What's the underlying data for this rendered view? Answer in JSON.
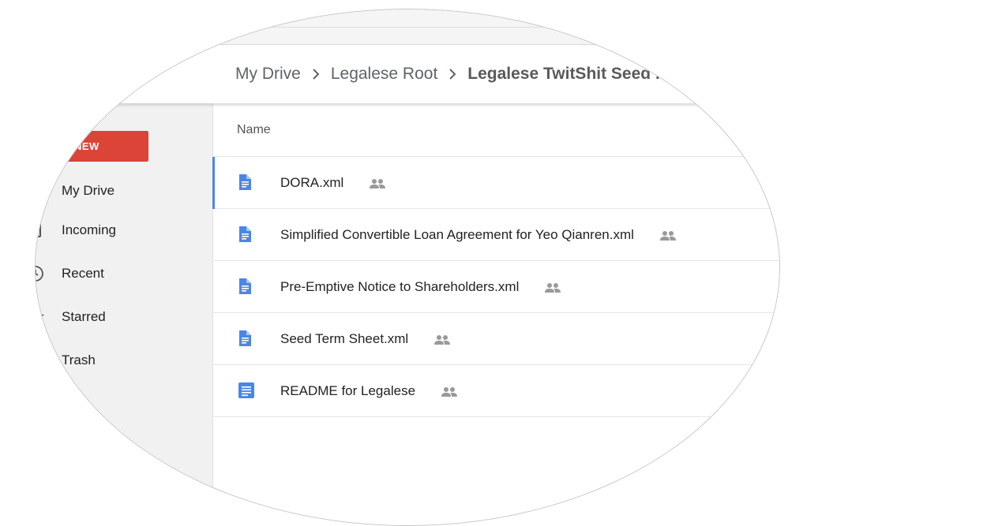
{
  "breadcrumb": {
    "items": [
      "My Drive",
      "Legalese Root"
    ],
    "current": "Legalese TwitShit Seed ."
  },
  "sidebar": {
    "new_label": "NEW",
    "items": [
      {
        "label": "My Drive",
        "icon": "drive-icon"
      },
      {
        "label": "Incoming",
        "icon": "incoming-icon"
      },
      {
        "label": "Recent",
        "icon": "clock-icon"
      },
      {
        "label": "Starred",
        "icon": "star-icon"
      },
      {
        "label": "Trash",
        "icon": "trash-icon"
      }
    ]
  },
  "list": {
    "column_name": "Name",
    "files": [
      {
        "name": "DORA.xml",
        "type": "file-icon",
        "shared": true,
        "selected": true
      },
      {
        "name": "Simplified Convertible Loan Agreement for Yeo Qianren.xml",
        "type": "file-icon",
        "shared": true
      },
      {
        "name": "Pre-Emptive Notice to Shareholders.xml",
        "type": "file-icon",
        "shared": true
      },
      {
        "name": "Seed Term Sheet.xml",
        "type": "file-icon",
        "shared": true
      },
      {
        "name": "README for Legalese",
        "type": "docs-icon",
        "shared": true
      }
    ]
  },
  "colors": {
    "accent": "#4a86e8",
    "new_button": "#db4437",
    "sidebar_bg": "#f1f1f1"
  }
}
